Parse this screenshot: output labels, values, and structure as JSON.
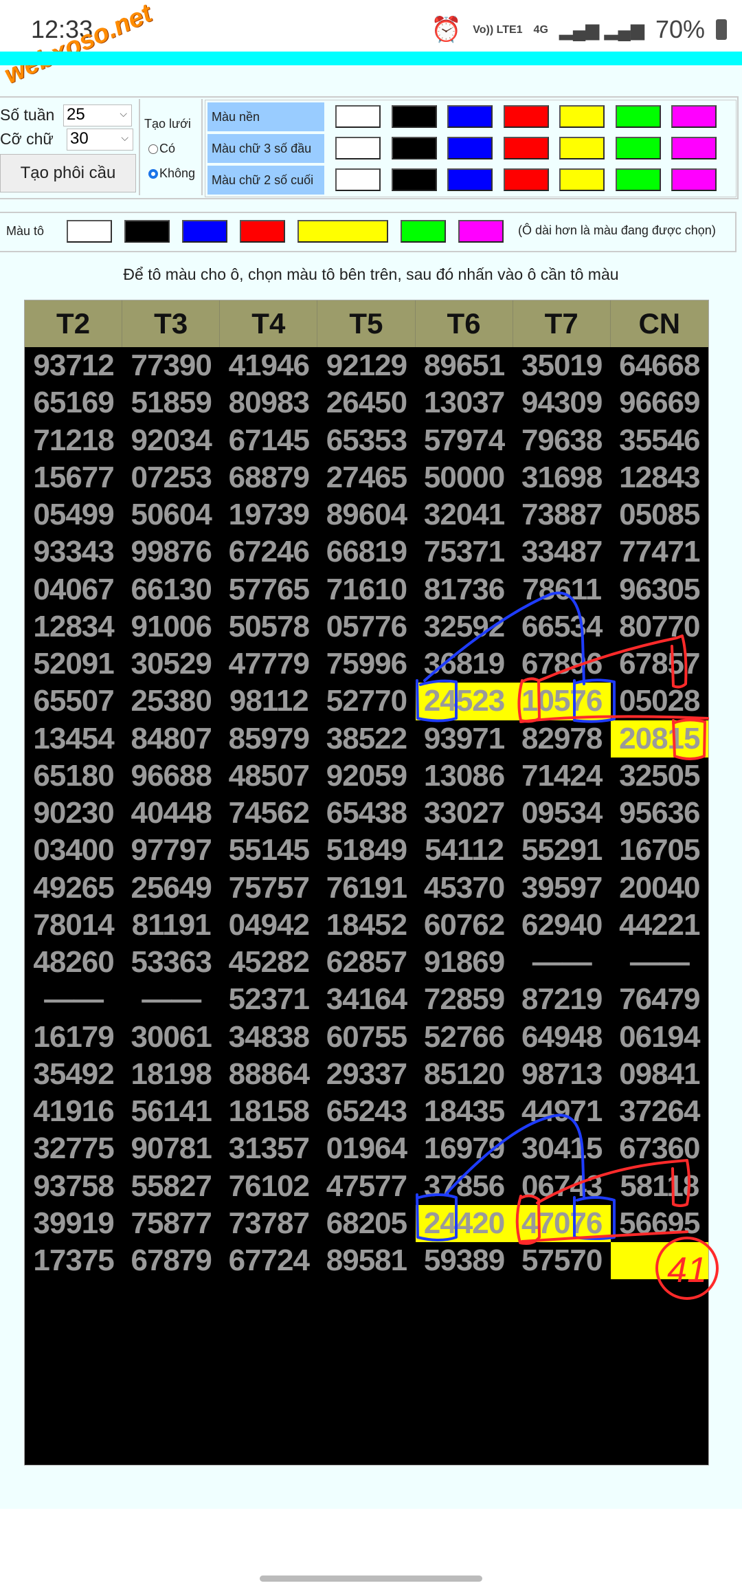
{
  "status_bar": {
    "time": "12:33",
    "network": "Vo)) LTE1",
    "net_type": "4G",
    "battery": "70%"
  },
  "watermark": "webxoso.net",
  "controls": {
    "weeks_label": "Số tuần",
    "weeks_value": "25",
    "font_label": "Cỡ chữ",
    "font_value": "30",
    "create_button": "Tạo phôi cầu",
    "grid_label": "Tạo lưới",
    "grid_yes": "Có",
    "grid_no": "Không",
    "grid_selected": "Không"
  },
  "color_rows": [
    {
      "label": "Màu nền"
    },
    {
      "label": "Màu chữ 3 số đầu"
    },
    {
      "label": "Màu chữ 2 số cuối"
    }
  ],
  "swatches": [
    "#ffffff",
    "#000000",
    "#0000ff",
    "#ff0000",
    "#ffff00",
    "#00ff00",
    "#ff00ff"
  ],
  "paint": {
    "label": "Màu tô",
    "selected": "#ffff00",
    "note": "(Ô dài hơn là màu đang được chọn)"
  },
  "instruction": "Để tô màu cho ô, chọn màu tô bên trên, sau đó nhấn vào ô cần tô màu",
  "table": {
    "headers": [
      "T2",
      "T3",
      "T4",
      "T5",
      "T6",
      "T7",
      "CN"
    ],
    "rows": [
      [
        "93712",
        "77390",
        "41946",
        "92129",
        "89651",
        "35019",
        "64668"
      ],
      [
        "65169",
        "51859",
        "80983",
        "26450",
        "13037",
        "94309",
        "96669"
      ],
      [
        "71218",
        "92034",
        "67145",
        "65353",
        "57974",
        "79638",
        "35546"
      ],
      [
        "15677",
        "07253",
        "68879",
        "27465",
        "50000",
        "31698",
        "12843"
      ],
      [
        "05499",
        "50604",
        "19739",
        "89604",
        "32041",
        "73887",
        "05085"
      ],
      [
        "93343",
        "99876",
        "67246",
        "66819",
        "75371",
        "33487",
        "77471"
      ],
      [
        "04067",
        "66130",
        "57765",
        "71610",
        "81736",
        "78611",
        "96305"
      ],
      [
        "12834",
        "91006",
        "50578",
        "05776",
        "32592",
        "66534",
        "80770"
      ],
      [
        "52091",
        "30529",
        "47779",
        "75996",
        "36819",
        "67896",
        "67857"
      ],
      [
        "65507",
        "25380",
        "98112",
        "52770",
        "24523",
        "10576",
        "05028"
      ],
      [
        "13454",
        "84807",
        "85979",
        "38522",
        "93971",
        "82978",
        "20815"
      ],
      [
        "65180",
        "96688",
        "48507",
        "92059",
        "13086",
        "71424",
        "32505"
      ],
      [
        "90230",
        "40448",
        "74562",
        "65438",
        "33027",
        "09534",
        "95636"
      ],
      [
        "03400",
        "97797",
        "55145",
        "51849",
        "54112",
        "55291",
        "16705"
      ],
      [
        "49265",
        "25649",
        "75757",
        "76191",
        "45370",
        "39597",
        "20040"
      ],
      [
        "78014",
        "81191",
        "04942",
        "18452",
        "60762",
        "62940",
        "44221"
      ],
      [
        "48260",
        "53363",
        "45282",
        "62857",
        "91869",
        "——",
        "——"
      ],
      [
        "——",
        "——",
        "52371",
        "34164",
        "72859",
        "87219",
        "76479"
      ],
      [
        "16179",
        "30061",
        "34838",
        "60755",
        "52766",
        "64948",
        "06194"
      ],
      [
        "35492",
        "18198",
        "88864",
        "29337",
        "85120",
        "98713",
        "09841"
      ],
      [
        "41916",
        "56141",
        "18158",
        "65243",
        "18435",
        "44971",
        "37264"
      ],
      [
        "32775",
        "90781",
        "31357",
        "01964",
        "16979",
        "30415",
        "67360"
      ],
      [
        "93758",
        "55827",
        "76102",
        "47577",
        "37856",
        "06743",
        "58118"
      ],
      [
        "39919",
        "75877",
        "73787",
        "68205",
        "24420",
        "47076",
        "56695"
      ],
      [
        "17375",
        "67879",
        "67724",
        "89581",
        "59389",
        "57570",
        ""
      ]
    ],
    "highlighted": [
      [
        9,
        4
      ],
      [
        9,
        5
      ],
      [
        10,
        6
      ],
      [
        23,
        4
      ],
      [
        23,
        5
      ],
      [
        24,
        6
      ]
    ],
    "highlight_color": "#ffff00"
  },
  "annotation_text": "41"
}
